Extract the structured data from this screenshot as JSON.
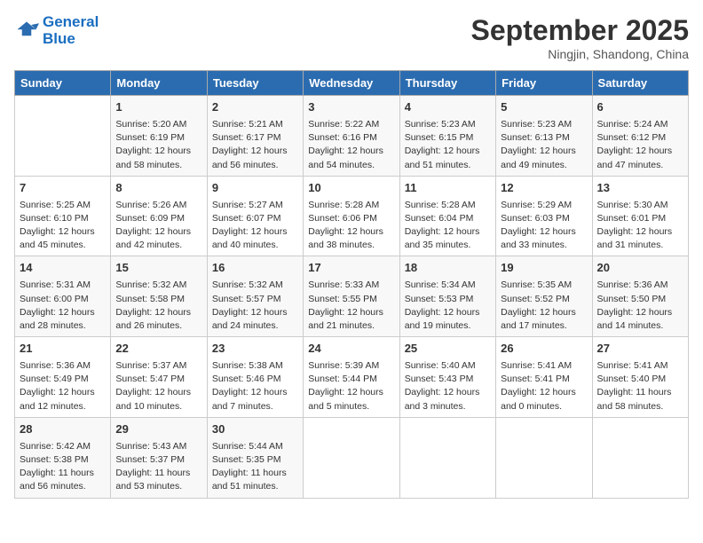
{
  "header": {
    "logo_line1": "General",
    "logo_line2": "Blue",
    "month": "September 2025",
    "location": "Ningjin, Shandong, China"
  },
  "weekdays": [
    "Sunday",
    "Monday",
    "Tuesday",
    "Wednesday",
    "Thursday",
    "Friday",
    "Saturday"
  ],
  "weeks": [
    [
      {
        "day": "",
        "info": ""
      },
      {
        "day": "1",
        "info": "Sunrise: 5:20 AM\nSunset: 6:19 PM\nDaylight: 12 hours\nand 58 minutes."
      },
      {
        "day": "2",
        "info": "Sunrise: 5:21 AM\nSunset: 6:17 PM\nDaylight: 12 hours\nand 56 minutes."
      },
      {
        "day": "3",
        "info": "Sunrise: 5:22 AM\nSunset: 6:16 PM\nDaylight: 12 hours\nand 54 minutes."
      },
      {
        "day": "4",
        "info": "Sunrise: 5:23 AM\nSunset: 6:15 PM\nDaylight: 12 hours\nand 51 minutes."
      },
      {
        "day": "5",
        "info": "Sunrise: 5:23 AM\nSunset: 6:13 PM\nDaylight: 12 hours\nand 49 minutes."
      },
      {
        "day": "6",
        "info": "Sunrise: 5:24 AM\nSunset: 6:12 PM\nDaylight: 12 hours\nand 47 minutes."
      }
    ],
    [
      {
        "day": "7",
        "info": "Sunrise: 5:25 AM\nSunset: 6:10 PM\nDaylight: 12 hours\nand 45 minutes."
      },
      {
        "day": "8",
        "info": "Sunrise: 5:26 AM\nSunset: 6:09 PM\nDaylight: 12 hours\nand 42 minutes."
      },
      {
        "day": "9",
        "info": "Sunrise: 5:27 AM\nSunset: 6:07 PM\nDaylight: 12 hours\nand 40 minutes."
      },
      {
        "day": "10",
        "info": "Sunrise: 5:28 AM\nSunset: 6:06 PM\nDaylight: 12 hours\nand 38 minutes."
      },
      {
        "day": "11",
        "info": "Sunrise: 5:28 AM\nSunset: 6:04 PM\nDaylight: 12 hours\nand 35 minutes."
      },
      {
        "day": "12",
        "info": "Sunrise: 5:29 AM\nSunset: 6:03 PM\nDaylight: 12 hours\nand 33 minutes."
      },
      {
        "day": "13",
        "info": "Sunrise: 5:30 AM\nSunset: 6:01 PM\nDaylight: 12 hours\nand 31 minutes."
      }
    ],
    [
      {
        "day": "14",
        "info": "Sunrise: 5:31 AM\nSunset: 6:00 PM\nDaylight: 12 hours\nand 28 minutes."
      },
      {
        "day": "15",
        "info": "Sunrise: 5:32 AM\nSunset: 5:58 PM\nDaylight: 12 hours\nand 26 minutes."
      },
      {
        "day": "16",
        "info": "Sunrise: 5:32 AM\nSunset: 5:57 PM\nDaylight: 12 hours\nand 24 minutes."
      },
      {
        "day": "17",
        "info": "Sunrise: 5:33 AM\nSunset: 5:55 PM\nDaylight: 12 hours\nand 21 minutes."
      },
      {
        "day": "18",
        "info": "Sunrise: 5:34 AM\nSunset: 5:53 PM\nDaylight: 12 hours\nand 19 minutes."
      },
      {
        "day": "19",
        "info": "Sunrise: 5:35 AM\nSunset: 5:52 PM\nDaylight: 12 hours\nand 17 minutes."
      },
      {
        "day": "20",
        "info": "Sunrise: 5:36 AM\nSunset: 5:50 PM\nDaylight: 12 hours\nand 14 minutes."
      }
    ],
    [
      {
        "day": "21",
        "info": "Sunrise: 5:36 AM\nSunset: 5:49 PM\nDaylight: 12 hours\nand 12 minutes."
      },
      {
        "day": "22",
        "info": "Sunrise: 5:37 AM\nSunset: 5:47 PM\nDaylight: 12 hours\nand 10 minutes."
      },
      {
        "day": "23",
        "info": "Sunrise: 5:38 AM\nSunset: 5:46 PM\nDaylight: 12 hours\nand 7 minutes."
      },
      {
        "day": "24",
        "info": "Sunrise: 5:39 AM\nSunset: 5:44 PM\nDaylight: 12 hours\nand 5 minutes."
      },
      {
        "day": "25",
        "info": "Sunrise: 5:40 AM\nSunset: 5:43 PM\nDaylight: 12 hours\nand 3 minutes."
      },
      {
        "day": "26",
        "info": "Sunrise: 5:41 AM\nSunset: 5:41 PM\nDaylight: 12 hours\nand 0 minutes."
      },
      {
        "day": "27",
        "info": "Sunrise: 5:41 AM\nSunset: 5:40 PM\nDaylight: 11 hours\nand 58 minutes."
      }
    ],
    [
      {
        "day": "28",
        "info": "Sunrise: 5:42 AM\nSunset: 5:38 PM\nDaylight: 11 hours\nand 56 minutes."
      },
      {
        "day": "29",
        "info": "Sunrise: 5:43 AM\nSunset: 5:37 PM\nDaylight: 11 hours\nand 53 minutes."
      },
      {
        "day": "30",
        "info": "Sunrise: 5:44 AM\nSunset: 5:35 PM\nDaylight: 11 hours\nand 51 minutes."
      },
      {
        "day": "",
        "info": ""
      },
      {
        "day": "",
        "info": ""
      },
      {
        "day": "",
        "info": ""
      },
      {
        "day": "",
        "info": ""
      }
    ]
  ]
}
